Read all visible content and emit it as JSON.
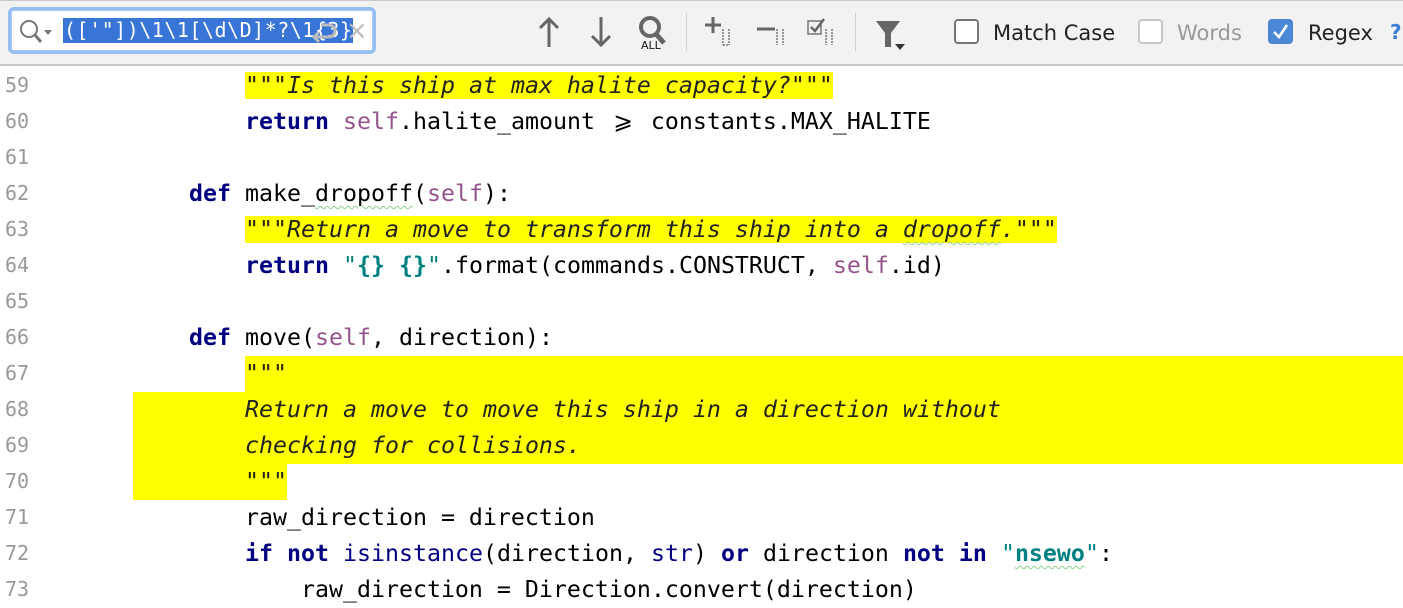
{
  "find_bar": {
    "query": "(['\"])\\1\\1[\\d\\D]*?\\1{3}",
    "icons": [
      "search-history-icon",
      "newline-icon",
      "clear-icon",
      "previous-occurrence-icon",
      "next-occurrence-icon",
      "select-all-occurrences-icon",
      "add-occurrence-icon",
      "remove-occurrence-icon",
      "toggle-selection-icon",
      "filter-icon",
      "help-icon"
    ],
    "options": [
      {
        "label": "Match Case",
        "checked": false,
        "enabled": true
      },
      {
        "label": "Words",
        "checked": false,
        "enabled": false
      },
      {
        "label": "Regex",
        "checked": true,
        "enabled": true
      }
    ],
    "help_label": "?",
    "all_label": "ALL"
  },
  "colors": {
    "match_highlight": "#ffff00",
    "keyword": "#000080",
    "self": "#94558d",
    "string": "#008080",
    "selection": "#3875d7"
  },
  "code_lines": [
    {
      "n": "59",
      "tokens": [
        [
          "",
          "            "
        ],
        [
          "dh",
          "\"\"\"Is this ship at max halite capacity?\"\"\""
        ]
      ]
    },
    {
      "n": "60",
      "tokens": [
        [
          "",
          "            "
        ],
        [
          "k",
          "return"
        ],
        [
          "",
          " "
        ],
        [
          "s",
          "self"
        ],
        [
          "",
          ".halite_amount "
        ],
        [
          "lig",
          "⩾"
        ],
        [
          "",
          " constants.MAX_HALITE"
        ]
      ]
    },
    {
      "n": "61",
      "tokens": []
    },
    {
      "n": "62",
      "tokens": [
        [
          "",
          "        "
        ],
        [
          "k",
          "def"
        ],
        [
          "",
          " make_"
        ],
        [
          "w",
          "dropoff"
        ],
        [
          "",
          "("
        ],
        [
          "s",
          "self"
        ],
        [
          "",
          "):"
        ]
      ]
    },
    {
      "n": "63",
      "tokens": [
        [
          "",
          "            "
        ],
        [
          "dh",
          "\"\"\"Return a move to transform this ship into a "
        ],
        [
          "dh w",
          "dropoff"
        ],
        [
          "dh",
          ".\"\"\""
        ]
      ]
    },
    {
      "n": "64",
      "tokens": [
        [
          "",
          "            "
        ],
        [
          "k",
          "return"
        ],
        [
          "",
          " "
        ],
        [
          "q",
          "\""
        ],
        [
          "sb",
          "{} {}"
        ],
        [
          "q",
          "\""
        ],
        [
          "",
          ".format(commands.CONSTRUCT, "
        ],
        [
          "s",
          "self"
        ],
        [
          "",
          ".id)"
        ]
      ]
    },
    {
      "n": "65",
      "tokens": []
    },
    {
      "n": "66",
      "tokens": [
        [
          "",
          "        "
        ],
        [
          "k",
          "def"
        ],
        [
          "",
          " move("
        ],
        [
          "s",
          "self"
        ],
        [
          "",
          ", direction):"
        ]
      ]
    },
    {
      "n": "67",
      "tokens": [
        [
          "",
          "            "
        ],
        [
          "d",
          "\"\"\""
        ]
      ]
    },
    {
      "n": "68",
      "tokens": [
        [
          "",
          "            "
        ],
        [
          "d",
          "Return a move to move this ship in a direction without"
        ]
      ]
    },
    {
      "n": "69",
      "tokens": [
        [
          "",
          "            "
        ],
        [
          "d",
          "checking for collisions."
        ]
      ]
    },
    {
      "n": "70",
      "tokens": [
        [
          "",
          "            "
        ],
        [
          "d",
          "\"\"\""
        ]
      ]
    },
    {
      "n": "71",
      "tokens": [
        [
          "",
          "            raw_direction = direction"
        ]
      ]
    },
    {
      "n": "72",
      "tokens": [
        [
          "",
          "            "
        ],
        [
          "k",
          "if not"
        ],
        [
          "",
          " "
        ],
        [
          "b",
          "isinstance"
        ],
        [
          "",
          "(direction, "
        ],
        [
          "b",
          "str"
        ],
        [
          ") ",
          ""
        ],
        [
          "",
          ") "
        ],
        [
          "k",
          "or"
        ],
        [
          "",
          " direction "
        ],
        [
          "k",
          "not in"
        ],
        [
          "",
          " "
        ],
        [
          "q",
          "\""
        ],
        [
          "sb w",
          "nsewo"
        ],
        [
          "q",
          "\""
        ],
        [
          "",
          ":"
        ]
      ]
    },
    {
      "n": "73",
      "tokens": [
        [
          "",
          "                raw_direction = Direction.convert(direction)"
        ]
      ]
    }
  ]
}
